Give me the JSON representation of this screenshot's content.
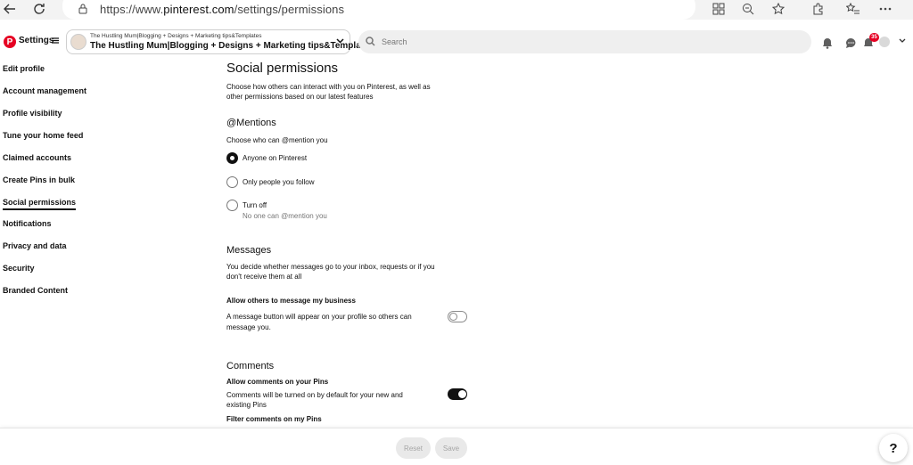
{
  "browser": {
    "url_prefix": "https://www.",
    "url_domain": "pinterest.com",
    "url_path": "/settings/permissions"
  },
  "header": {
    "settings_label": "Settings",
    "account_small": "The Hustling Mum|Blogging + Designs + Marketing tips&Templates",
    "account_name": "The Hustling Mum|Blogging + Designs + Marketing tips&Templates",
    "search_placeholder": "Search",
    "update_count": "35"
  },
  "sidebar": {
    "items": [
      {
        "label": "Edit profile"
      },
      {
        "label": "Account management"
      },
      {
        "label": "Profile visibility"
      },
      {
        "label": "Tune your home feed"
      },
      {
        "label": "Claimed accounts"
      },
      {
        "label": "Create Pins in bulk"
      },
      {
        "label": "Social permissions"
      },
      {
        "label": "Notifications"
      },
      {
        "label": "Privacy and data"
      },
      {
        "label": "Security"
      },
      {
        "label": "Branded Content"
      }
    ],
    "active_index": 6
  },
  "main": {
    "title": "Social permissions",
    "intro_line1": "Choose how others can interact with you on Pinterest, as well as",
    "intro_line2": "other permissions based on our latest features",
    "mentions": {
      "heading": "@Mentions",
      "description": "Choose who can @mention you",
      "options": [
        {
          "label": "Anyone on Pinterest",
          "selected": true
        },
        {
          "label": "Only people you follow",
          "selected": false
        },
        {
          "label": "Turn off",
          "selected": false,
          "sublabel": "No one can @mention you"
        }
      ]
    },
    "messages": {
      "heading": "Messages",
      "desc_line1": "You decide whether messages go to your inbox, requests or if you",
      "desc_line2": "don't receive them at all",
      "allow_title": "Allow others to message my business",
      "allow_desc_line1": "A message button will appear on your profile so others can",
      "allow_desc_line2": "message you.",
      "allow_enabled": false
    },
    "comments": {
      "heading": "Comments",
      "allow_title": "Allow comments on your Pins",
      "allow_desc_line1": "Comments will be turned on by default for your new and",
      "allow_desc_line2": "existing Pins",
      "allow_enabled": true,
      "filter_title": "Filter comments on my Pins"
    }
  },
  "footer": {
    "reset_label": "Reset",
    "save_label": "Save",
    "help_label": "?"
  }
}
